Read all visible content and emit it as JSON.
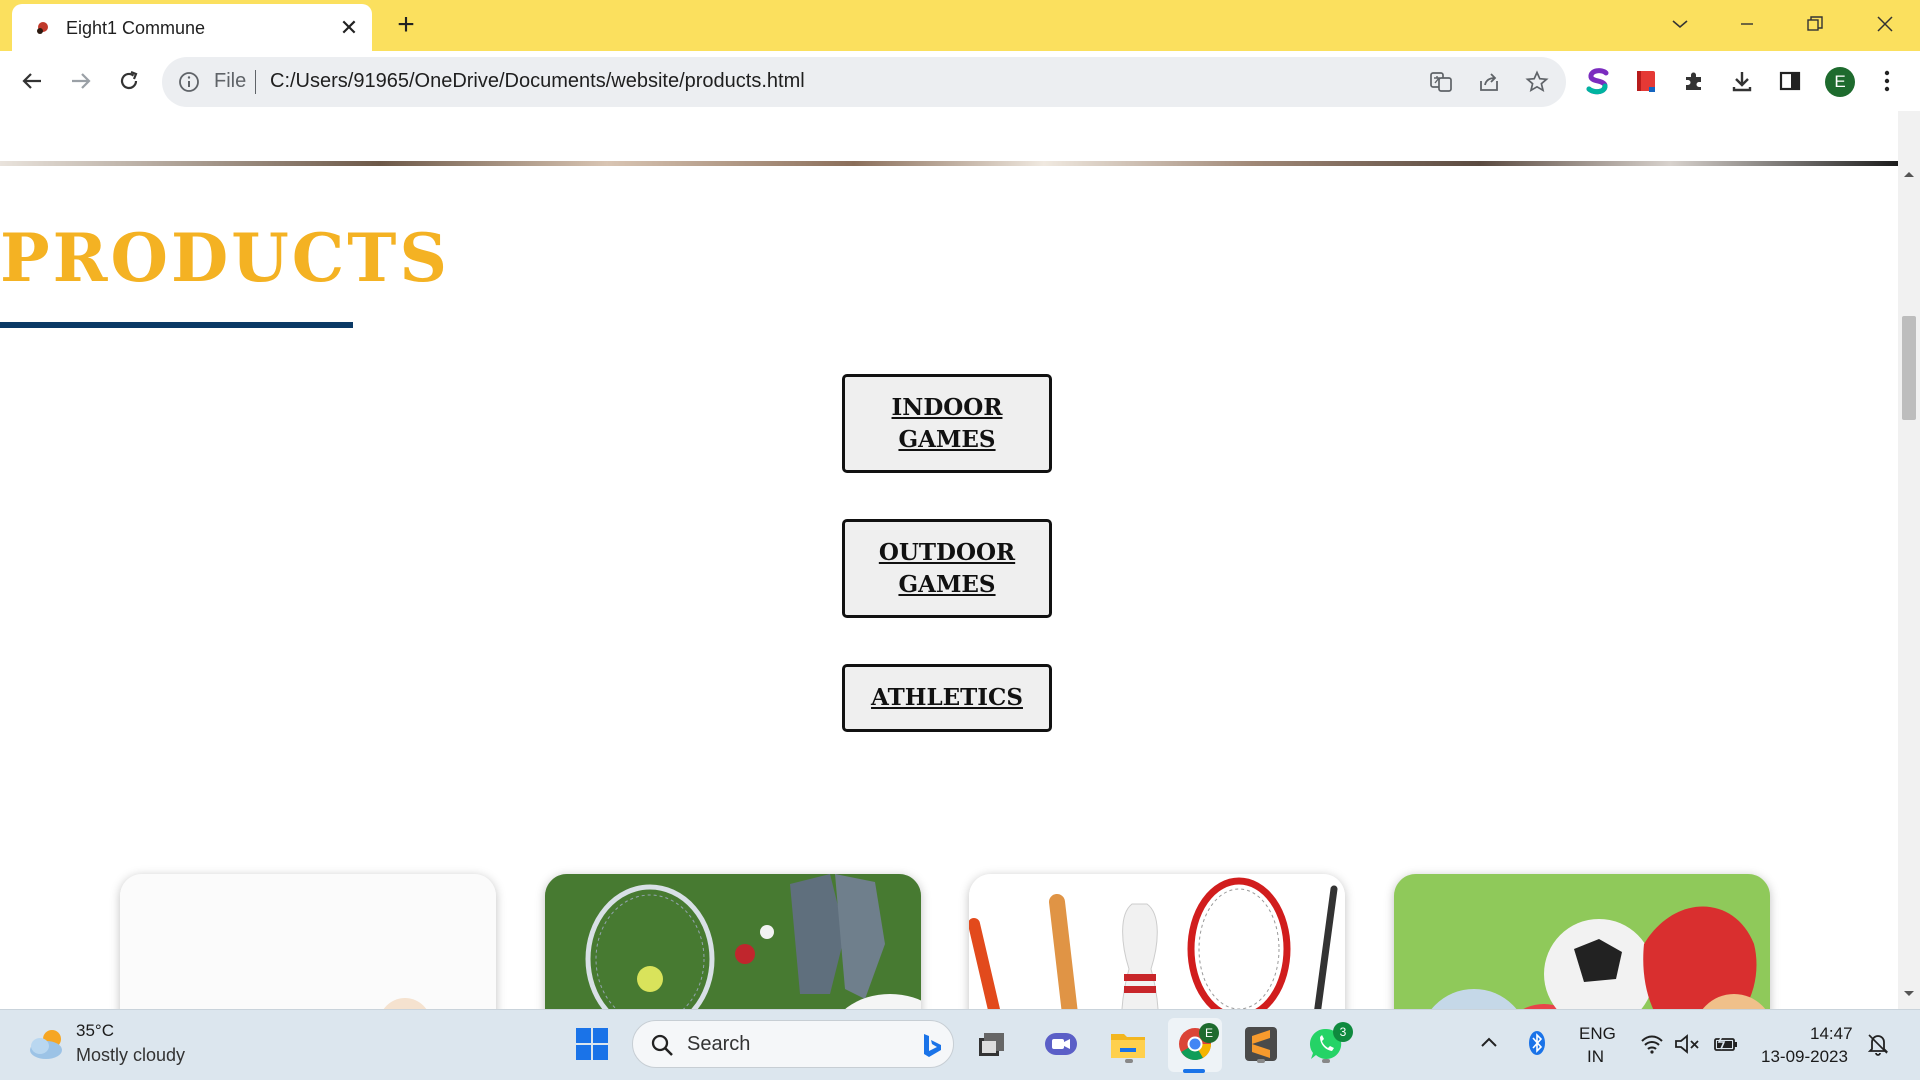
{
  "browser": {
    "tab_title": "Eight1 Commune",
    "url_scheme": "File",
    "url": "C:/Users/91965/OneDrive/Documents/website/products.html",
    "profile_initial": "E"
  },
  "page": {
    "title": "PRODUCTS",
    "categories": [
      {
        "label": "INDOOR GAMES"
      },
      {
        "label": "OUTDOOR GAMES"
      },
      {
        "label": "ATHLETICS"
      }
    ]
  },
  "taskbar": {
    "temperature": "35°C",
    "weather": "Mostly cloudy",
    "search_label": "Search",
    "chrome_badge": "E",
    "whatsapp_badge": "3",
    "lang_primary": "ENG",
    "lang_secondary": "IN",
    "time": "14:47",
    "date": "13-09-2023"
  },
  "colors": {
    "tab_strip": "#fbe05e",
    "title": "#f4b223",
    "underline": "#0b3a66"
  }
}
